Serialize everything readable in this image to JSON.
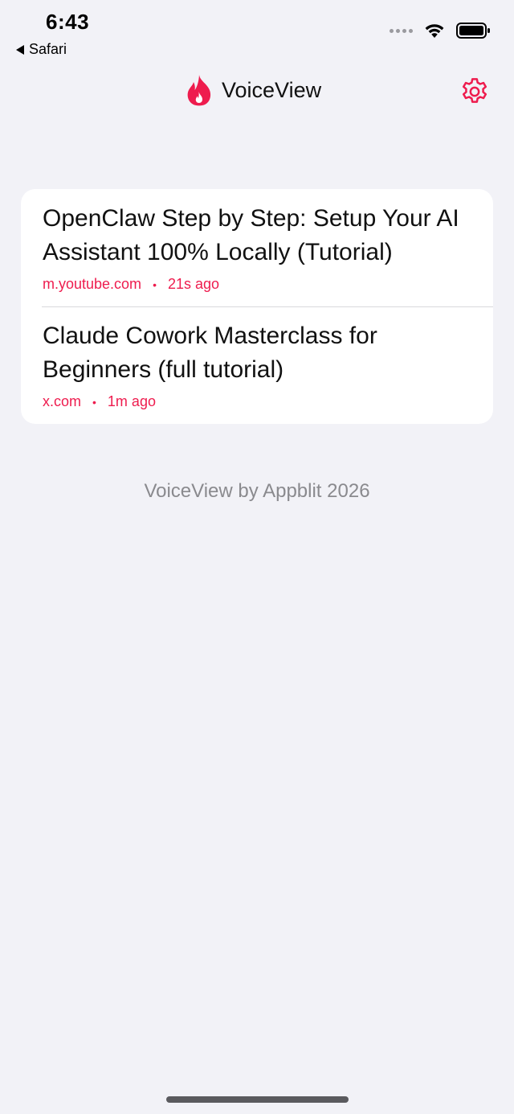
{
  "status_bar": {
    "time": "6:43",
    "back_label": "Safari"
  },
  "nav": {
    "app_title": "VoiceView",
    "brand_color": "#ee1c4e"
  },
  "items": [
    {
      "title": "OpenClaw Step by Step: Setup Your AI Assistant 100% Locally (Tutorial)",
      "source": "m.youtube.com",
      "separator": "•",
      "time_ago": "21s ago"
    },
    {
      "title": "Claude Cowork Masterclass for Beginners (full tutorial)",
      "source": "x.com",
      "separator": "•",
      "time_ago": "1m ago"
    }
  ],
  "footer": {
    "text": "VoiceView by Appblit 2026"
  }
}
